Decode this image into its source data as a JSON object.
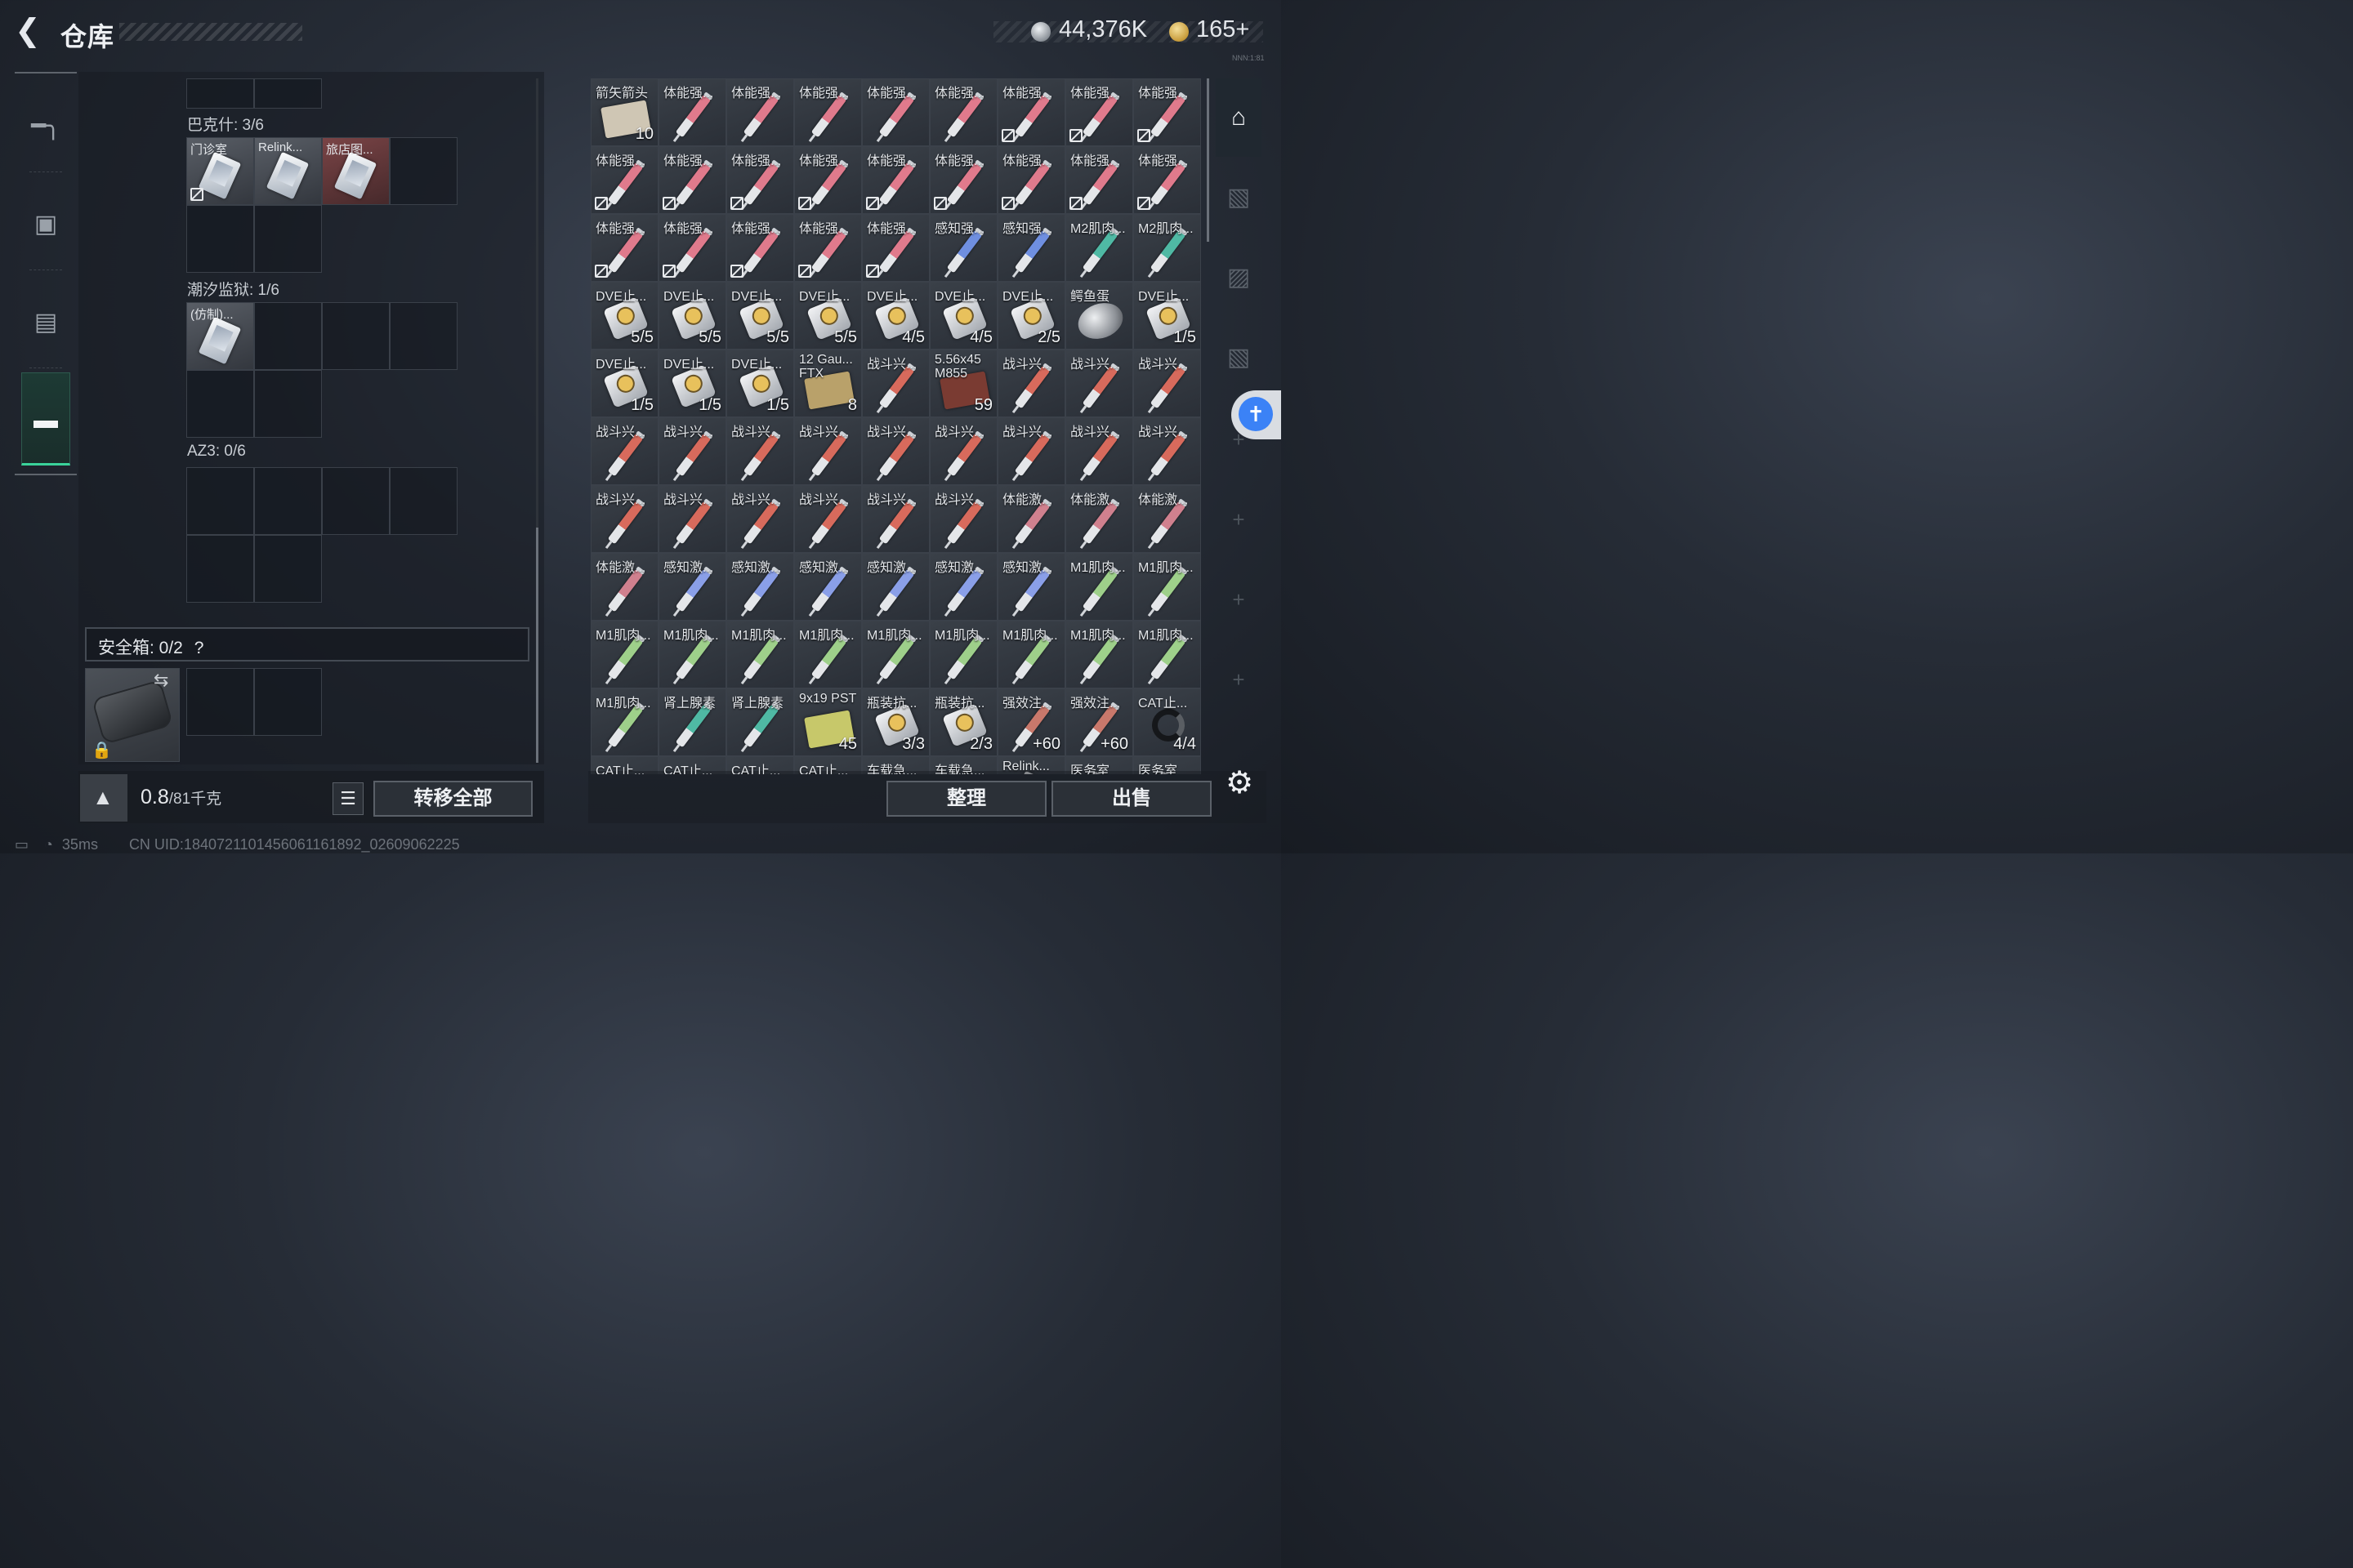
{
  "header": {
    "back_icon": "back-arrow-icon",
    "title": "仓库"
  },
  "currency": {
    "silver_icon": "silver-coin-icon",
    "silver": "44,376K",
    "gold_icon": "gold-coin-icon",
    "gold": "165+"
  },
  "sidebar": {
    "items": [
      {
        "icon": "pistol-icon",
        "active": false
      },
      {
        "icon": "backpack-icon",
        "active": false
      },
      {
        "icon": "vest-icon",
        "active": false
      },
      {
        "icon": "toolbox-icon",
        "active": true
      }
    ]
  },
  "containers": [
    {
      "label": "巴克什: 3/6",
      "rows": 2,
      "cols": 4,
      "slots": [
        {
          "row": 0,
          "col": 0,
          "name": "门诊室",
          "kind": "card",
          "tone": "grey",
          "nosell": true
        },
        {
          "row": 0,
          "col": 1,
          "name": "Relink...",
          "kind": "card",
          "tone": "grey",
          "nosell": false
        },
        {
          "row": 0,
          "col": 2,
          "name": "旅店图...",
          "kind": "card",
          "tone": "red",
          "nosell": false
        }
      ]
    },
    {
      "label": "潮汐监狱: 1/6",
      "rows": 2,
      "cols": 4,
      "slots": [
        {
          "row": 0,
          "col": 0,
          "name": "(仿制)...",
          "kind": "card",
          "tone": "grey",
          "nosell": false
        }
      ]
    },
    {
      "label": "AZ3: 0/6",
      "rows": 2,
      "cols": 4,
      "slots": []
    }
  ],
  "safe_box": {
    "label": "安全箱: 0/2",
    "help": "?",
    "swap_icon": "swap-arrows-icon",
    "lock_icon": "lock-icon"
  },
  "bottom_left": {
    "weight_icon": "weight-kg-icon",
    "weight_value": "0.8",
    "weight_capacity": "/81千克",
    "list_icon": "list-icon",
    "transfer_all": "转移全部"
  },
  "bottom_right": {
    "sort": "整理",
    "sell": "出售",
    "settings_icon": "gear-icon"
  },
  "status": {
    "battery_icon": "battery-icon",
    "wifi_icon": "wifi-icon",
    "ping": "35ms",
    "uid": "CN UID:1840721101456061161892_02609062225"
  },
  "build_tag": "NNN:1:81",
  "right_tabs": [
    {
      "icon": "home-vault-icon",
      "active": true
    },
    {
      "icon": "shelf-iii-icon"
    },
    {
      "icon": "shelf-iv-icon"
    },
    {
      "icon": "shelf-iii-b-icon"
    },
    {
      "icon": "add-icon"
    },
    {
      "icon": "add-icon"
    },
    {
      "icon": "add-icon"
    },
    {
      "icon": "add-icon"
    }
  ],
  "accessibility_icon": "accessibility-icon",
  "colors": {
    "accent": "#3ad39a",
    "pink_syringe": "#e07a8c",
    "blue_syringe": "#6f8fe0",
    "teal_syringe": "#4fb9a4",
    "red_syringe": "#d86a5c",
    "green_syringe": "#9ed08a",
    "slate_syringe": "#8a9fe8",
    "mauve_syringe": "#d0808e"
  },
  "inventory": [
    [
      {
        "name": "箭矢箭头",
        "count": "10",
        "kind": "box",
        "color": "#cfc6b4"
      },
      {
        "name": "体能强...",
        "kind": "syringe",
        "color": "#e07a8c"
      },
      {
        "name": "体能强...",
        "kind": "syringe",
        "color": "#e07a8c"
      },
      {
        "name": "体能强...",
        "kind": "syringe",
        "color": "#e07a8c"
      },
      {
        "name": "体能强...",
        "kind": "syringe",
        "color": "#e07a8c"
      },
      {
        "name": "体能强...",
        "kind": "syringe",
        "color": "#e07a8c"
      },
      {
        "name": "体能强...",
        "kind": "syringe",
        "color": "#e07a8c",
        "nosell": true
      },
      {
        "name": "体能强...",
        "kind": "syringe",
        "color": "#e07a8c",
        "nosell": true
      },
      {
        "name": "体能强...",
        "kind": "syringe",
        "color": "#e07a8c",
        "nosell": true
      }
    ],
    [
      {
        "name": "体能强...",
        "kind": "syringe",
        "color": "#e07a8c",
        "nosell": true
      },
      {
        "name": "体能强...",
        "kind": "syringe",
        "color": "#e07a8c",
        "nosell": true
      },
      {
        "name": "体能强...",
        "kind": "syringe",
        "color": "#e07a8c",
        "nosell": true
      },
      {
        "name": "体能强...",
        "kind": "syringe",
        "color": "#e07a8c",
        "nosell": true
      },
      {
        "name": "体能强...",
        "kind": "syringe",
        "color": "#e07a8c",
        "nosell": true
      },
      {
        "name": "体能强...",
        "kind": "syringe",
        "color": "#e07a8c",
        "nosell": true
      },
      {
        "name": "体能强...",
        "kind": "syringe",
        "color": "#e07a8c",
        "nosell": true
      },
      {
        "name": "体能强...",
        "kind": "syringe",
        "color": "#e07a8c",
        "nosell": true
      },
      {
        "name": "体能强...",
        "kind": "syringe",
        "color": "#e07a8c",
        "nosell": true
      }
    ],
    [
      {
        "name": "体能强...",
        "kind": "syringe",
        "color": "#e07a8c",
        "nosell": true
      },
      {
        "name": "体能强...",
        "kind": "syringe",
        "color": "#e07a8c",
        "nosell": true
      },
      {
        "name": "体能强...",
        "kind": "syringe",
        "color": "#e07a8c",
        "nosell": true
      },
      {
        "name": "体能强...",
        "kind": "syringe",
        "color": "#e07a8c",
        "nosell": true
      },
      {
        "name": "体能强...",
        "kind": "syringe",
        "color": "#e07a8c",
        "nosell": true
      },
      {
        "name": "感知强...",
        "kind": "syringe",
        "color": "#6f8fe0"
      },
      {
        "name": "感知强...",
        "kind": "syringe",
        "color": "#6f8fe0"
      },
      {
        "name": "M2肌肉...",
        "kind": "syringe",
        "color": "#4fb9a4"
      },
      {
        "name": "M2肌肉...",
        "kind": "syringe",
        "color": "#4fb9a4"
      }
    ],
    [
      {
        "name": "DVE止...",
        "count": "5/5",
        "kind": "can"
      },
      {
        "name": "DVE止...",
        "count": "5/5",
        "kind": "can"
      },
      {
        "name": "DVE止...",
        "count": "5/5",
        "kind": "can"
      },
      {
        "name": "DVE止...",
        "count": "5/5",
        "kind": "can"
      },
      {
        "name": "DVE止...",
        "count": "4/5",
        "kind": "can"
      },
      {
        "name": "DVE止...",
        "count": "4/5",
        "kind": "can"
      },
      {
        "name": "DVE止...",
        "count": "2/5",
        "kind": "can"
      },
      {
        "name": "鳄鱼蛋",
        "kind": "egg"
      },
      {
        "name": "DVE止...",
        "count": "1/5",
        "kind": "can"
      }
    ],
    [
      {
        "name": "DVE止...",
        "count": "1/5",
        "kind": "can"
      },
      {
        "name": "DVE止...",
        "count": "1/5",
        "kind": "can"
      },
      {
        "name": "DVE止...",
        "count": "1/5",
        "kind": "can"
      },
      {
        "name": "12 Gau... FTX",
        "count": "8",
        "kind": "box",
        "color": "#b9a16a"
      },
      {
        "name": "战斗兴...",
        "kind": "syringe",
        "color": "#d86a5c"
      },
      {
        "name": "5.56x45 M855",
        "count": "59",
        "kind": "box",
        "color": "#7a3b32"
      },
      {
        "name": "战斗兴...",
        "kind": "syringe",
        "color": "#d86a5c"
      },
      {
        "name": "战斗兴...",
        "kind": "syringe",
        "color": "#d86a5c"
      },
      {
        "name": "战斗兴...",
        "kind": "syringe",
        "color": "#d86a5c"
      }
    ],
    [
      {
        "name": "战斗兴...",
        "kind": "syringe",
        "color": "#d86a5c"
      },
      {
        "name": "战斗兴...",
        "kind": "syringe",
        "color": "#d86a5c"
      },
      {
        "name": "战斗兴...",
        "kind": "syringe",
        "color": "#d86a5c"
      },
      {
        "name": "战斗兴...",
        "kind": "syringe",
        "color": "#d86a5c"
      },
      {
        "name": "战斗兴...",
        "kind": "syringe",
        "color": "#d86a5c"
      },
      {
        "name": "战斗兴...",
        "kind": "syringe",
        "color": "#d86a5c"
      },
      {
        "name": "战斗兴...",
        "kind": "syringe",
        "color": "#d86a5c"
      },
      {
        "name": "战斗兴...",
        "kind": "syringe",
        "color": "#d86a5c"
      },
      {
        "name": "战斗兴...",
        "kind": "syringe",
        "color": "#d86a5c"
      }
    ],
    [
      {
        "name": "战斗兴...",
        "kind": "syringe",
        "color": "#d86a5c"
      },
      {
        "name": "战斗兴...",
        "kind": "syringe",
        "color": "#d86a5c"
      },
      {
        "name": "战斗兴...",
        "kind": "syringe",
        "color": "#d86a5c"
      },
      {
        "name": "战斗兴...",
        "kind": "syringe",
        "color": "#d86a5c"
      },
      {
        "name": "战斗兴...",
        "kind": "syringe",
        "color": "#d86a5c"
      },
      {
        "name": "战斗兴...",
        "kind": "syringe",
        "color": "#d86a5c"
      },
      {
        "name": "体能激...",
        "kind": "syringe",
        "color": "#d0808e"
      },
      {
        "name": "体能激...",
        "kind": "syringe",
        "color": "#d0808e"
      },
      {
        "name": "体能激...",
        "kind": "syringe",
        "color": "#d0808e"
      }
    ],
    [
      {
        "name": "体能激...",
        "kind": "syringe",
        "color": "#d0808e"
      },
      {
        "name": "感知激...",
        "kind": "syringe",
        "color": "#8a9fe8"
      },
      {
        "name": "感知激...",
        "kind": "syringe",
        "color": "#8a9fe8"
      },
      {
        "name": "感知激...",
        "kind": "syringe",
        "color": "#8a9fe8"
      },
      {
        "name": "感知激...",
        "kind": "syringe",
        "color": "#8a9fe8"
      },
      {
        "name": "感知激...",
        "kind": "syringe",
        "color": "#8a9fe8"
      },
      {
        "name": "感知激...",
        "kind": "syringe",
        "color": "#8a9fe8"
      },
      {
        "name": "M1肌肉...",
        "kind": "syringe",
        "color": "#9ed08a"
      },
      {
        "name": "M1肌肉...",
        "kind": "syringe",
        "color": "#9ed08a"
      }
    ],
    [
      {
        "name": "M1肌肉...",
        "kind": "syringe",
        "color": "#9ed08a"
      },
      {
        "name": "M1肌肉...",
        "kind": "syringe",
        "color": "#9ed08a"
      },
      {
        "name": "M1肌肉...",
        "kind": "syringe",
        "color": "#9ed08a"
      },
      {
        "name": "M1肌肉...",
        "kind": "syringe",
        "color": "#9ed08a"
      },
      {
        "name": "M1肌肉...",
        "kind": "syringe",
        "color": "#9ed08a"
      },
      {
        "name": "M1肌肉...",
        "kind": "syringe",
        "color": "#9ed08a"
      },
      {
        "name": "M1肌肉...",
        "kind": "syringe",
        "color": "#9ed08a"
      },
      {
        "name": "M1肌肉...",
        "kind": "syringe",
        "color": "#9ed08a"
      },
      {
        "name": "M1肌肉...",
        "kind": "syringe",
        "color": "#9ed08a"
      }
    ],
    [
      {
        "name": "M1肌肉...",
        "kind": "syringe",
        "color": "#9ed08a"
      },
      {
        "name": "肾上腺素",
        "kind": "syringe",
        "color": "#4fb9a4"
      },
      {
        "name": "肾上腺素",
        "kind": "syringe",
        "color": "#4fb9a4"
      },
      {
        "name": "9x19 PST",
        "count": "45",
        "kind": "box",
        "color": "#c7c86a"
      },
      {
        "name": "瓶装抗...",
        "count": "3/3",
        "kind": "can"
      },
      {
        "name": "瓶装抗...",
        "count": "2/3",
        "kind": "can"
      },
      {
        "name": "强效注...",
        "count": "+60",
        "kind": "syringe",
        "color": "#c9786b"
      },
      {
        "name": "强效注...",
        "count": "+60",
        "kind": "syringe",
        "color": "#c9786b"
      },
      {
        "name": "CAT止...",
        "count": "4/4",
        "kind": "tq"
      }
    ],
    [
      {
        "name": "CAT止...",
        "kind": "tq"
      },
      {
        "name": "CAT止...",
        "kind": "tq"
      },
      {
        "name": "CAT止...",
        "kind": "tq"
      },
      {
        "name": "CAT止...",
        "kind": "tq"
      },
      {
        "name": "车载急...",
        "kind": "box",
        "color": "#5b6169"
      },
      {
        "name": "车载急...",
        "kind": "box",
        "color": "#5b6169"
      },
      {
        "name": "Relink...",
        "kind": "card"
      },
      {
        "name": "医务室",
        "kind": "card"
      },
      {
        "name": "医务室",
        "kind": "card"
      }
    ]
  ]
}
